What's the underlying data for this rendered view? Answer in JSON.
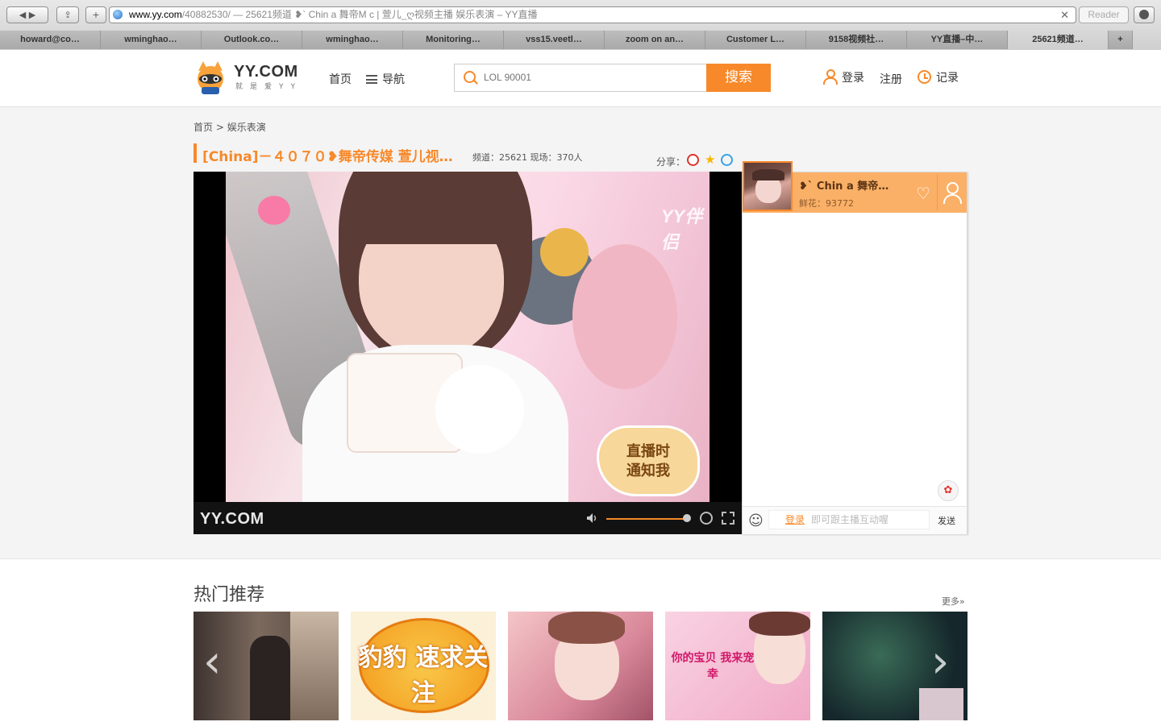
{
  "browser": {
    "url_host": "www.yy.com",
    "url_rest": "/40882530/ — 25621频道 ❥` Chin a 舞帝M c | 萱儿_ღ视频主播 娱乐表演 – YY直播",
    "reader_label": "Reader",
    "tabs": [
      "howard@co…",
      "wminghao…",
      "Outlook.co…",
      "wminghao…",
      "Monitoring…",
      "vss15.veetl…",
      "zoom on an…",
      "Customer L…",
      "9158视频社…",
      "YY直播–中…",
      "25621频道…"
    ],
    "new_tab_label": "+"
  },
  "header": {
    "logo_text": "YY.COM",
    "logo_sub": "就是爱YY",
    "nav_home": "首页",
    "nav_menu": "导航",
    "search_placeholder": "LOL 90001",
    "search_button": "搜索",
    "login": "登录",
    "register": "注册",
    "history": "记录"
  },
  "breadcrumb": {
    "home": "首页",
    "sep": ">",
    "current": "娱乐表演"
  },
  "room": {
    "title": "[China]－４０７０❥舞帝传媒 萱儿视…",
    "channel_label": "频道：25621",
    "audience_label": "现场：370人",
    "share_label": "分享："
  },
  "player": {
    "watermark": "YY.COM",
    "corner_mark": "YY伴侣",
    "notify_line1": "直播时",
    "notify_line2": "通知我",
    "volume": 0.95
  },
  "chat": {
    "anchor_name": "❥` Chin a 舞帝…",
    "flowers": "鲜花：93772",
    "login_link": "登录",
    "input_hint": "即可跟主播互动喔",
    "send": "发送"
  },
  "hot": {
    "title": "热门推荐",
    "more": "更多»",
    "thumbs": [
      {
        "caption": "",
        "color": "#6b5a4a"
      },
      {
        "caption": "豹豹 速求关注",
        "color": "#f7b233"
      },
      {
        "caption": "",
        "color": "#e6a9b3"
      },
      {
        "caption": "你的宝贝 我来宠幸",
        "color": "#f3b6cf"
      },
      {
        "caption": "",
        "color": "#1f3a3c"
      }
    ]
  },
  "colors": {
    "accent": "#f7892a",
    "anchor_bar": "#fbb067"
  }
}
